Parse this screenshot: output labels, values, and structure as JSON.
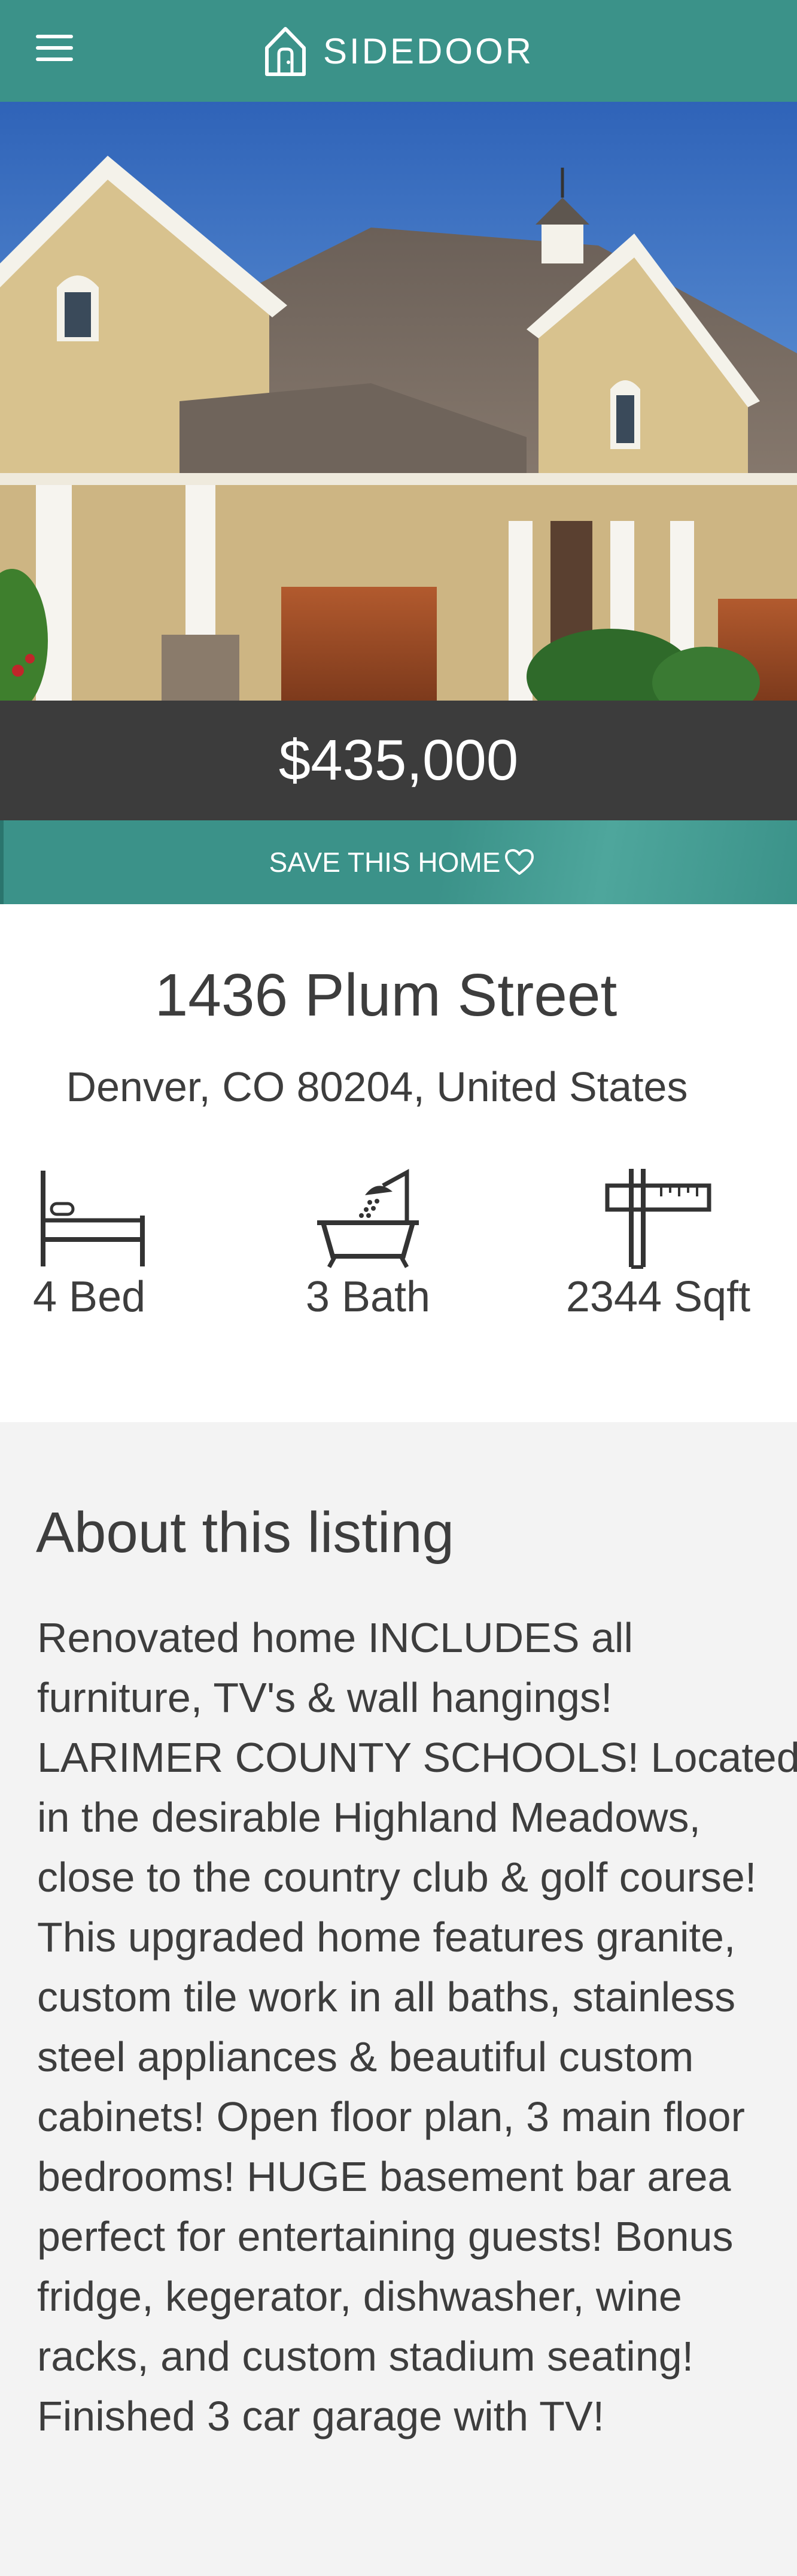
{
  "header": {
    "brand": "SIDEDOOR",
    "menu_icon": "hamburger-icon",
    "logo_icon": "house-door-icon",
    "color": "#3b9289"
  },
  "listing": {
    "price": "$435,000",
    "save_label": "SAVE THIS HOME",
    "save_icon": "heart-icon",
    "street": "1436 Plum Street",
    "city": "Denver, CO 80204, United States",
    "stats": {
      "bed": "4 Bed",
      "bath": "3 Bath",
      "sqft": "2344 Sqft"
    }
  },
  "about": {
    "title": "About this listing",
    "description": "Renovated home INCLUDES all furniture, TV's & wall hangings! LARIMER COUNTY SCHOOLS! Located in the desirable Highland Meadows, close to the country club & golf course! This upgraded home features granite, custom tile work in all baths, stainless steel appliances & beautiful custom cabinets! Open floor plan, 3 main floor bedrooms! HUGE basement bar area perfect for entertaining guests! Bonus fridge, kegerator, dishwasher, wine racks, and custom stadium seating! Finished 3 car garage with TV!"
  }
}
